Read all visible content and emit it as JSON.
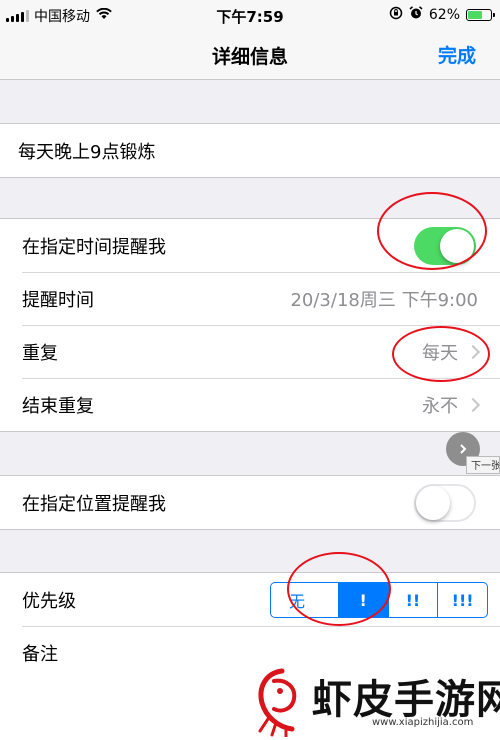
{
  "status_bar": {
    "carrier": "中国移动",
    "time": "下午7:59",
    "battery_percent": "62%",
    "battery_level": 0.62
  },
  "nav": {
    "title": "详细信息",
    "done_label": "完成"
  },
  "reminder_title": "每天晚上9点锻炼",
  "time_section": {
    "remind_at_time_label": "在指定时间提醒我",
    "remind_at_time_on": true,
    "alarm_label": "提醒时间",
    "alarm_value": "20/3/18周三 下午9:00",
    "repeat_label": "重复",
    "repeat_value": "每天",
    "end_repeat_label": "结束重复",
    "end_repeat_value": "永不"
  },
  "location_section": {
    "remind_at_location_label": "在指定位置提醒我",
    "remind_at_location_on": false
  },
  "priority_section": {
    "priority_label": "优先级",
    "options": [
      "无",
      "!",
      "!!",
      "!!!"
    ],
    "selected": "!",
    "notes_label": "备注"
  },
  "next_page": {
    "label": "下一张"
  },
  "watermark": {
    "text": "虾皮手游网",
    "url": "www.xiapizhijia.com"
  },
  "colors": {
    "accent": "#007aff",
    "toggle_on": "#4cd964",
    "annotation": "#e8101a"
  }
}
